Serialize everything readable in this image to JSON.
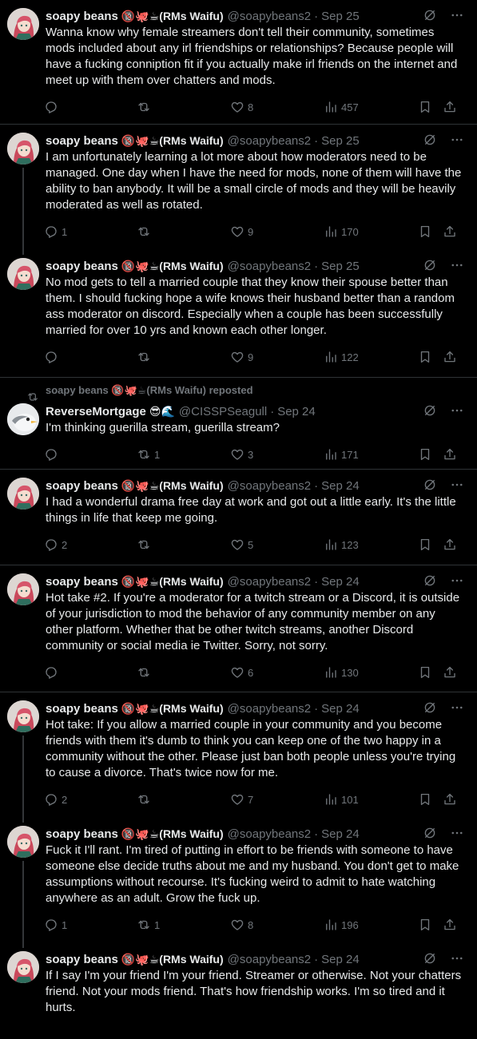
{
  "tweets": [
    {
      "name": "soapy beans",
      "emoji": "🔞🐙☕(RMs Waifu)",
      "handle": "@soapybeans2",
      "date": "Sep 25",
      "text": "Wanna know why female streamers don't tell their community, sometimes mods included about any irl friendships or relationships? Because people will have a fucking conniption fit if you actually make irl friends on the internet and meet up with them over chatters and mods.",
      "replies": "",
      "reposts": "",
      "likes": "8",
      "views": "457"
    },
    {
      "name": "soapy beans",
      "emoji": "🔞🐙☕(RMs Waifu)",
      "handle": "@soapybeans2",
      "date": "Sep 25",
      "text": "I am unfortunately learning a lot more about how moderators need to be managed. One day when I have the need for mods, none of them will have the ability to ban anybody. It will be a small circle of mods and they will be heavily moderated as well as rotated.",
      "replies": "1",
      "reposts": "",
      "likes": "9",
      "views": "170"
    },
    {
      "name": "soapy beans",
      "emoji": "🔞🐙☕(RMs Waifu)",
      "handle": "@soapybeans2",
      "date": "Sep 25",
      "text": "No mod gets to tell a married couple that they know their spouse better than them. I should fucking hope a wife knows their husband better than a random ass moderator on discord. Especially when a couple has been successfully married for over 10 yrs and known each other longer.",
      "replies": "",
      "reposts": "",
      "likes": "9",
      "views": "122"
    },
    {
      "repost_by": "soapy beans 🔞🐙☕(RMs Waifu) reposted",
      "name": "ReverseMortgage",
      "emoji": "😎🌊",
      "handle": "@CISSPSeagull",
      "date": "Sep 24",
      "text": "I'm thinking guerilla stream, guerilla stream?",
      "replies": "",
      "reposts": "1",
      "likes": "3",
      "views": "171"
    },
    {
      "name": "soapy beans",
      "emoji": "🔞🐙☕(RMs Waifu)",
      "handle": "@soapybeans2",
      "date": "Sep 24",
      "text": "I had a wonderful drama free day at work and got out a little early. It's the little things in life that keep me going.",
      "replies": "2",
      "reposts": "",
      "likes": "5",
      "views": "123"
    },
    {
      "name": "soapy beans",
      "emoji": "🔞🐙☕(RMs Waifu)",
      "handle": "@soapybeans2",
      "date": "Sep 24",
      "text": "Hot take #2. If you're a moderator for a twitch stream or a Discord, it is outside of your jurisdiction to mod the behavior of any community member on any other platform. Whether that be other twitch streams, another Discord community or social media ie Twitter. Sorry, not sorry.",
      "replies": "",
      "reposts": "",
      "likes": "6",
      "views": "130"
    },
    {
      "name": "soapy beans",
      "emoji": "🔞🐙☕(RMs Waifu)",
      "handle": "@soapybeans2",
      "date": "Sep 24",
      "text": "Hot take: If you allow a married couple in your community and you become friends with them it's dumb to think you can keep one of the two happy in a community without the other. Please just ban both people unless you're trying to cause a divorce. That's twice now for me.",
      "replies": "2",
      "reposts": "",
      "likes": "7",
      "views": "101"
    },
    {
      "name": "soapy beans",
      "emoji": "🔞🐙☕(RMs Waifu)",
      "handle": "@soapybeans2",
      "date": "Sep 24",
      "text": "Fuck it I'll rant. I'm tired of putting in effort to be friends with someone to have someone else decide truths about me and my husband. You don't get to make assumptions without recourse. It's fucking weird to admit to hate watching anywhere as an adult. Grow the fuck up.",
      "replies": "1",
      "reposts": "1",
      "likes": "8",
      "views": "196"
    },
    {
      "name": "soapy beans",
      "emoji": "🔞🐙☕(RMs Waifu)",
      "handle": "@soapybeans2",
      "date": "Sep 24",
      "text": "If I say I'm your friend I'm your friend. Streamer or otherwise. Not your chatters friend. Not your mods friend. That's how friendship works. I'm so tired and it hurts.",
      "replies": "",
      "reposts": "",
      "likes": "",
      "views": ""
    }
  ],
  "icons": {
    "reply": "reply-icon",
    "repost": "repost-icon",
    "like": "heart-icon",
    "views": "views-icon",
    "bookmark": "bookmark-icon",
    "share": "share-icon",
    "grok": "grok-icon",
    "more": "more-icon"
  },
  "colors": {
    "background": "#000000",
    "text": "#e7e9ea",
    "muted": "#71767b",
    "divider": "#2f3336"
  }
}
